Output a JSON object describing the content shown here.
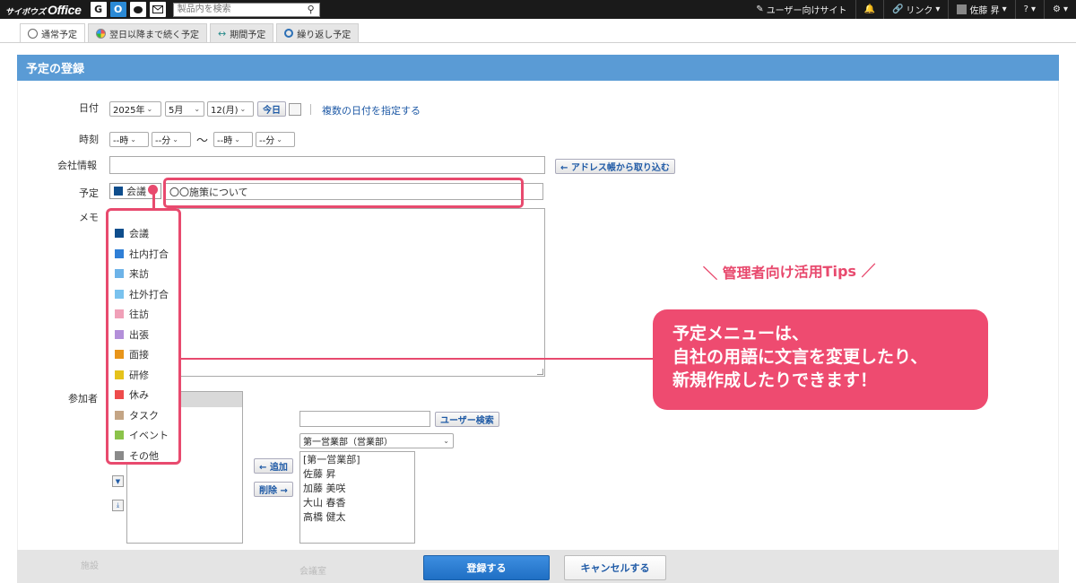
{
  "header": {
    "logo_small": "サイボウズ",
    "logo_big": "Office",
    "app_icons": [
      "G",
      "O",
      "",
      ""
    ],
    "search_placeholder": "製品内を検索",
    "user_site": "ユーザー向けサイト",
    "link_label": "リンク",
    "user_name": "佐藤 昇",
    "help_label": "?",
    "settings_label": "⚙"
  },
  "tabs": [
    {
      "label": "通常予定",
      "active": true
    },
    {
      "label": "翌日以降まで続く予定",
      "active": false
    },
    {
      "label": "期間予定",
      "active": false
    },
    {
      "label": "繰り返し予定",
      "active": false
    }
  ],
  "panel": {
    "title": "予定の登録"
  },
  "form": {
    "date_label": "日付",
    "year": "2025年",
    "month": "5月",
    "day": "12(月)",
    "today_button": "今日",
    "multi_date_link": "複数の日付を指定する",
    "time_label": "時刻",
    "hour_start": "--時",
    "min_start": "--分",
    "tilde": "〜",
    "hour_end": "--時",
    "min_end": "--分",
    "company_label": "会社情報",
    "address_button": "← アドレス帳から取り込む",
    "schedule_label": "予定",
    "category_selected": "会議",
    "title_value": "〇〇施策について",
    "memo_label": "メモ",
    "participants_label": "参加者",
    "user_search_button": "ユーザー検索",
    "group_select": "第一営業部（営業部）",
    "add_button": "← 追加",
    "remove_button": "削除 →",
    "users": [
      "[第一営業部]",
      "佐藤 昇",
      "加藤 美咲",
      "大山 春香",
      "高橋 健太"
    ],
    "ghost_label": "施設",
    "ghost_select": "会議室"
  },
  "categories": [
    {
      "label": "会議",
      "color": "#0e4d8c"
    },
    {
      "label": "社内打合",
      "color": "#2f7fd6"
    },
    {
      "label": "来訪",
      "color": "#6db3e8"
    },
    {
      "label": "社外打合",
      "color": "#79c2ee"
    },
    {
      "label": "往訪",
      "color": "#f0a0b8"
    },
    {
      "label": "出張",
      "color": "#b38fd9"
    },
    {
      "label": "面接",
      "color": "#e8951a"
    },
    {
      "label": "研修",
      "color": "#e5c21a"
    },
    {
      "label": "休み",
      "color": "#ee4b4b"
    },
    {
      "label": "タスク",
      "color": "#c4a585"
    },
    {
      "label": "イベント",
      "color": "#8bc34a"
    },
    {
      "label": "その他",
      "color": "#8a8a8a"
    }
  ],
  "annotation": {
    "tips": "＼ 管理者向け活用Tips ／",
    "line1": "予定メニューは、",
    "line2": "自社の用語に文言を変更したり、",
    "line3": "新規作成したりできます！",
    "accent": "#e84a6e"
  },
  "footer": {
    "submit": "登録する",
    "cancel": "キャンセルする"
  }
}
